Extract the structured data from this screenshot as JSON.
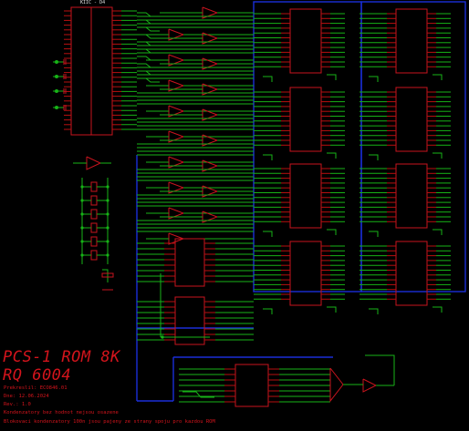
{
  "schematic": {
    "connector_label": "KIIC - D4",
    "title_line1": "PCS-1 ROM 8K",
    "title_line2": "RQ 6004",
    "notes": [
      "Prekreslil: ECO846.01",
      "Dne: 12.06.2024",
      "Rev.: 1.0",
      "Kondenzatory bez hodnot nejsou osazene",
      "Blokovaci kondenzatory 100n jsou pajeny ze strany spoju pro kazdou ROM"
    ]
  },
  "colors": {
    "background": "#000000",
    "component": "#c8141e",
    "wire": "#17b317",
    "bus": "#1a2ed8",
    "text": "#d4141c"
  }
}
